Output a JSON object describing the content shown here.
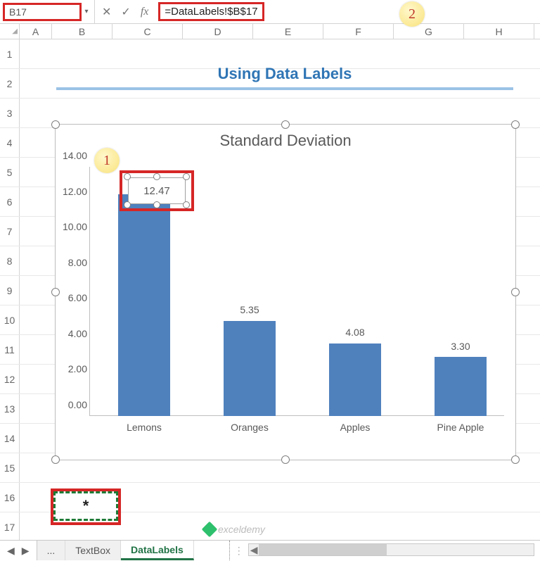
{
  "name_box": "B17",
  "formula_bar": {
    "cancel": "✕",
    "confirm": "✓",
    "fx": "fx",
    "value": "=DataLabels!$B$17"
  },
  "callouts": {
    "one": "1",
    "two": "2"
  },
  "columns": [
    "A",
    "B",
    "C",
    "D",
    "E",
    "F",
    "G",
    "H"
  ],
  "rows": [
    "1",
    "2",
    "3",
    "4",
    "5",
    "6",
    "7",
    "8",
    "9",
    "10",
    "11",
    "12",
    "13",
    "14",
    "15",
    "16",
    "17"
  ],
  "page_title": "Using Data Labels",
  "chart": {
    "title": "Standard Deviation",
    "y_ticks": [
      "0.00",
      "2.00",
      "4.00",
      "6.00",
      "8.00",
      "10.00",
      "12.00",
      "14.00"
    ]
  },
  "chart_data": {
    "type": "bar",
    "title": "Standard Deviation",
    "categories": [
      "Lemons",
      "Oranges",
      "Apples",
      "Pine Apple"
    ],
    "values": [
      12.47,
      5.35,
      4.08,
      3.3
    ],
    "labels": [
      "12.47",
      "5.35",
      "4.08",
      "3.30"
    ],
    "xlabel": "",
    "ylabel": "",
    "ylim": [
      0,
      14
    ]
  },
  "selected_cell_value": "*",
  "tabs": {
    "ellipsis": "...",
    "textbox": "TextBox",
    "datalabels": "DataLabels"
  },
  "watermark": "exceldemy"
}
